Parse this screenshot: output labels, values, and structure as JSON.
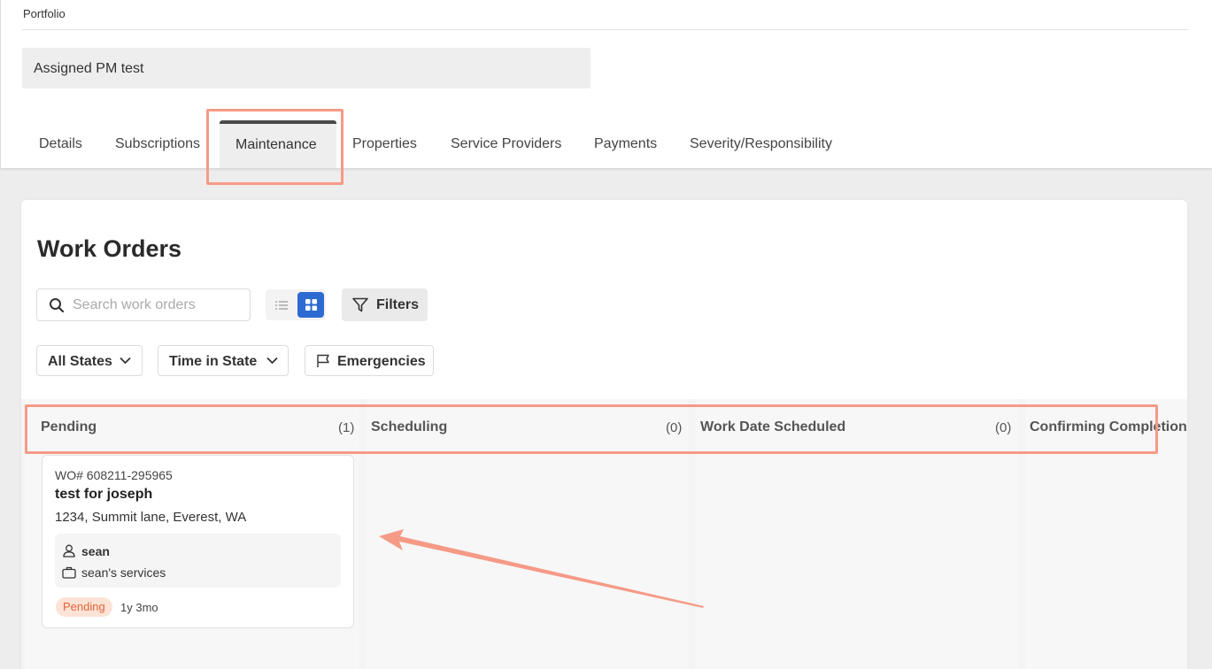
{
  "breadcrumb": "Portfolio",
  "portfolio_name": "Assigned PM test",
  "tabs": [
    {
      "label": "Details"
    },
    {
      "label": "Subscriptions"
    },
    {
      "label": "Maintenance",
      "active": true
    },
    {
      "label": "Properties"
    },
    {
      "label": "Service Providers"
    },
    {
      "label": "Payments"
    },
    {
      "label": "Severity/Responsibility"
    }
  ],
  "page_title": "Work Orders",
  "search": {
    "placeholder": "Search work orders",
    "value": ""
  },
  "filters_label": "Filters",
  "dropdowns": {
    "states": "All States",
    "time_in_state": "Time in State",
    "emergencies": "Emergencies"
  },
  "columns": [
    {
      "name": "Pending",
      "count": "(1)"
    },
    {
      "name": "Scheduling",
      "count": "(0)"
    },
    {
      "name": "Work Date Scheduled",
      "count": "(0)"
    },
    {
      "name": "Confirming Completion",
      "count": ""
    }
  ],
  "work_order": {
    "number": "WO# 608211-295965",
    "title": "test for joseph",
    "address": "1234, Summit lane, Everest, WA",
    "assignee": "sean",
    "vendor": "sean's services",
    "status": "Pending",
    "age": "1y 3mo"
  },
  "colors": {
    "accent": "#2d6bd2",
    "highlight": "#f59a87",
    "pending_badge_bg": "#fde3d6",
    "pending_badge_text": "#e2643a"
  }
}
